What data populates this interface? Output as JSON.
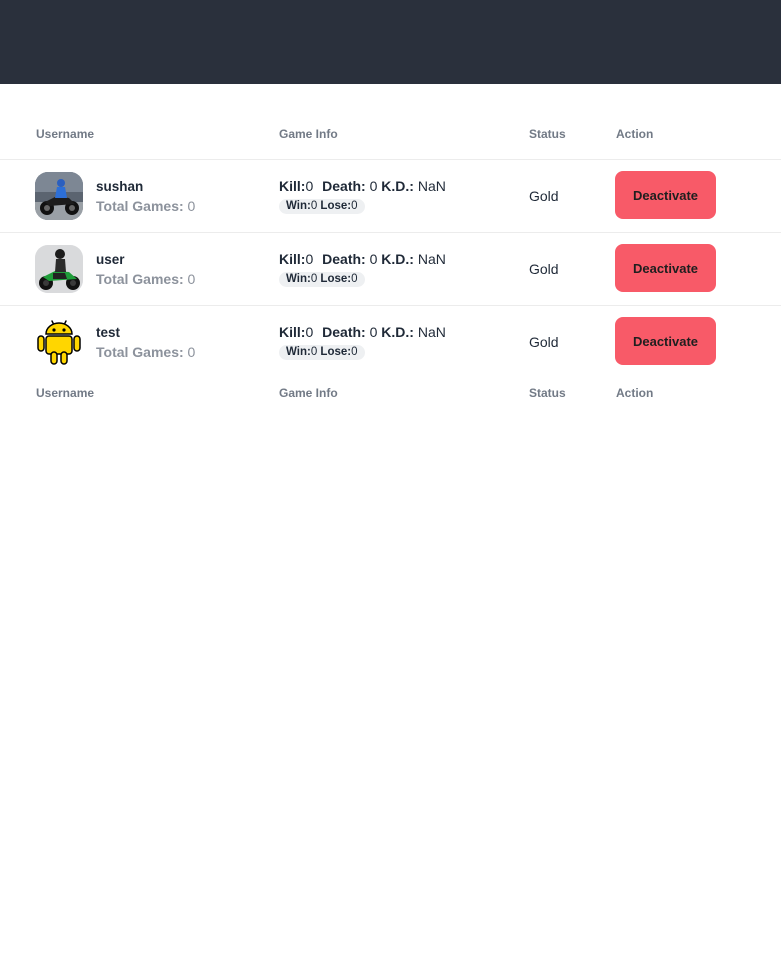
{
  "columns": {
    "username": "Username",
    "game_info": "Game Info",
    "status": "Status",
    "action": "Action"
  },
  "labels": {
    "total_games": "Total Games:",
    "kill": "Kill:",
    "death": "Death:",
    "kd": "K.D.:",
    "win": "Win:",
    "lose": "Lose:"
  },
  "users": [
    {
      "username": "sushan",
      "total_games": "0",
      "kill": "0",
      "death": "0",
      "kd": "NaN",
      "win": "0",
      "lose": "0",
      "status": "Gold",
      "action": "Deactivate",
      "avatar": "motorbike-rider-photo"
    },
    {
      "username": "user",
      "total_games": "0",
      "kill": "0",
      "death": "0",
      "kd": "NaN",
      "win": "0",
      "lose": "0",
      "status": "Gold",
      "action": "Deactivate",
      "avatar": "green-motorbike-photo"
    },
    {
      "username": "test",
      "total_games": "0",
      "kill": "0",
      "death": "0",
      "kd": "NaN",
      "win": "0",
      "lose": "0",
      "status": "Gold",
      "action": "Deactivate",
      "avatar": "android-robot-icon"
    }
  ],
  "colors": {
    "topbar": "#2a303c",
    "deactivate_button": "#f85a68",
    "android_yellow": "#ffd600"
  }
}
